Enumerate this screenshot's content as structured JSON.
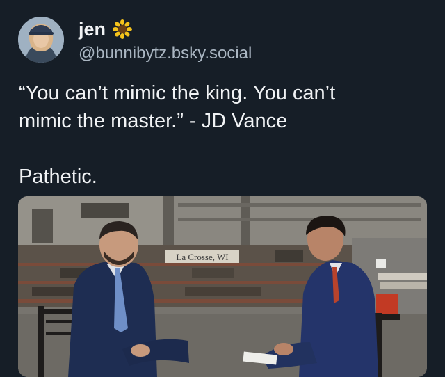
{
  "author": {
    "display_name": "jen",
    "handle": "@bunnibytz.bsky.social",
    "avatar_icon": "avatar-photo",
    "emoji_icon": "sunflower-icon"
  },
  "post": {
    "text_lines": [
      "“You can’t mimic the king. You can’t",
      "mimic the master.” - JD Vance"
    ],
    "text_para2": "Pathetic."
  },
  "media": {
    "kind": "video-still",
    "location_sign": "La Crosse, WI",
    "colors": {
      "background": "#161e27",
      "handle": "#aab6c2",
      "text": "#f1f3f5"
    }
  }
}
